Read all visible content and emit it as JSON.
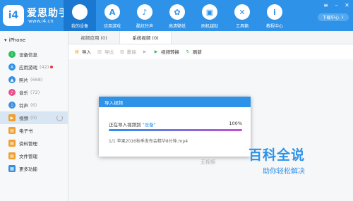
{
  "brand": {
    "logo_text": "i4",
    "name": "爱思助手",
    "url": "www.i4.cn"
  },
  "nav": [
    {
      "label": "我的设备",
      "icon": "apple-icon",
      "glyph": "",
      "active": true
    },
    {
      "label": "应用游戏",
      "icon": "appstore-icon",
      "glyph": "A"
    },
    {
      "label": "酷炫铃声",
      "icon": "bell-icon",
      "glyph": "♪"
    },
    {
      "label": "高清壁纸",
      "icon": "wallpaper-icon",
      "glyph": "✿"
    },
    {
      "label": "刷机越狱",
      "icon": "box-icon",
      "glyph": "▣"
    },
    {
      "label": "工具箱",
      "icon": "tools-icon",
      "glyph": "✕"
    },
    {
      "label": "教程中心",
      "icon": "info-icon",
      "glyph": "i"
    }
  ],
  "window": {
    "download_center": "下载中心"
  },
  "device": {
    "name": "iPhone"
  },
  "sidebar": {
    "items": [
      {
        "label": "设备信息",
        "count": "",
        "icon": "info-icon",
        "glyph": "i",
        "color": "#2dbd5a"
      },
      {
        "label": "应用游戏",
        "count": "(42)",
        "icon": "app-icon",
        "glyph": "A",
        "color": "#2e92e8",
        "badge": true
      },
      {
        "label": "照片",
        "count": "(668)",
        "icon": "photo-icon",
        "glyph": "▲",
        "color": "#3a8fdb"
      },
      {
        "label": "音乐",
        "count": "(72)",
        "icon": "music-icon",
        "glyph": "♪",
        "color": "#e8508a"
      },
      {
        "label": "铃声",
        "count": "(6)",
        "icon": "ringtone-icon",
        "glyph": "♫",
        "color": "#3a8fdb"
      },
      {
        "label": "视频",
        "count": "(0)",
        "icon": "video-icon",
        "glyph": "▶",
        "color": "#f0a030",
        "active": true
      },
      {
        "label": "电子书",
        "count": "",
        "icon": "book-icon",
        "glyph": "▤",
        "color": "#f0a030"
      },
      {
        "label": "资料管理",
        "count": "",
        "icon": "contacts-icon",
        "glyph": "▤",
        "color": "#f0a030"
      },
      {
        "label": "文件管理",
        "count": "",
        "icon": "folder-icon",
        "glyph": "▤",
        "color": "#f0a030"
      },
      {
        "label": "更多功能",
        "count": "",
        "icon": "more-icon",
        "glyph": "▦",
        "color": "#3a8fdb"
      }
    ]
  },
  "tabs": [
    {
      "label": "视频应用 (0)"
    },
    {
      "label": "系统视频 (0)",
      "active": true
    }
  ],
  "toolbar": [
    {
      "label": "导入",
      "icon": "import-icon",
      "disabled": false
    },
    {
      "label": "导出",
      "icon": "export-icon",
      "disabled": true
    },
    {
      "label": "删除",
      "icon": "delete-icon",
      "disabled": true
    },
    {
      "label": "",
      "icon": "play-icon",
      "disabled": true
    },
    {
      "label": "视频转换",
      "icon": "convert-icon",
      "disabled": false
    },
    {
      "label": "刷新",
      "icon": "refresh-icon",
      "disabled": false
    }
  ],
  "empty_text": "无视频",
  "dialog": {
    "title": "导入视频",
    "progress_prefix": "正在导入视频到",
    "progress_device": "\"设备\"",
    "progress_percent": "100%",
    "progress_value": 1.0,
    "file_line": "1/1  苹果2016秋季发布会精华8分钟.mp4"
  },
  "watermark": {
    "title": "百科全说",
    "subtitle": "助你轻松解决"
  },
  "colors": {
    "accent": "#2e92e8",
    "nav_active": "#1b78d0"
  }
}
